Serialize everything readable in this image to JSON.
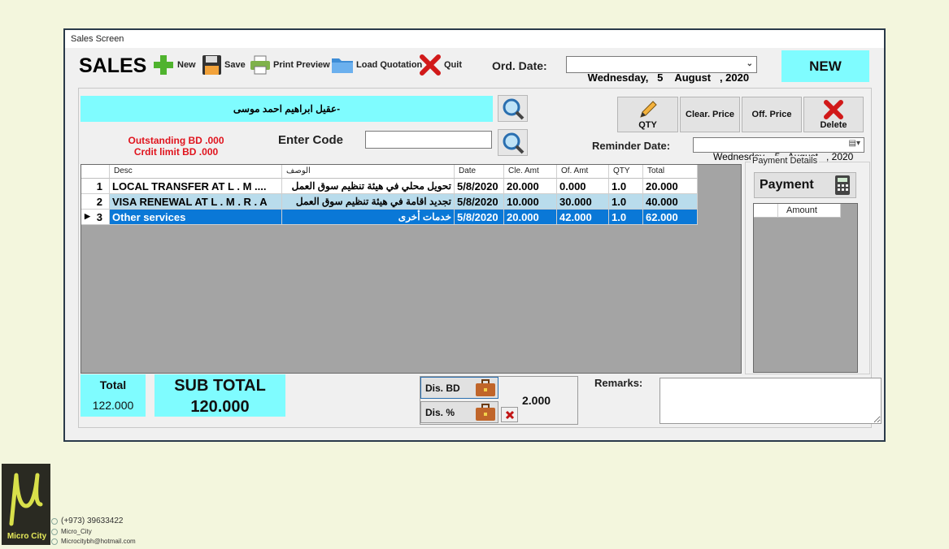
{
  "window": {
    "title": "Sales Screen"
  },
  "toolbar": {
    "app_title": "SALES",
    "new_label": "New",
    "save_label": "Save",
    "print_label": "Print Preview",
    "load_label": "Load Quotation",
    "quit_label": "Quit",
    "ord_date_label": "Ord. Date:",
    "ord_date_value": "Wednesday,   5    August   , 2020",
    "status_badge": "NEW"
  },
  "customer": {
    "name": "عقيل ابراهيم احمد موسى-",
    "outstanding": "Outstanding BD .000",
    "credit_limit": "Crdit limit BD .000",
    "enter_code_label": "Enter Code",
    "code_value": ""
  },
  "actions": {
    "qty_label": "QTY",
    "clear_price_label": "Clear. Price",
    "off_price_label": "Off. Price",
    "delete_label": "Delete",
    "reminder_label": "Reminder Date:",
    "reminder_value": "Wednesday,   5   August   , 2020"
  },
  "grid": {
    "columns": [
      "Desc",
      "الوصف",
      "Date",
      "Cle. Amt",
      "Of. Amt",
      "QTY",
      "Total"
    ],
    "rows": [
      {
        "num": "1",
        "desc": "LOCAL TRANSFER AT L . M ....",
        "desc_ar": "تحويل محلي في هيئة تنظيم سوق العمل",
        "date": "5/8/2020",
        "cle": "20.000",
        "of": "0.000",
        "qty": "1.0",
        "total": "20.000"
      },
      {
        "num": "2",
        "desc": "VISA RENEWAL AT L . M . R . A",
        "desc_ar": "تجديد اقامة في هيئة تنظيم سوق العمل",
        "date": "5/8/2020",
        "cle": "10.000",
        "of": "30.000",
        "qty": "1.0",
        "total": "40.000"
      },
      {
        "num": "3",
        "desc": "Other services",
        "desc_ar": "خدمات أخرى",
        "date": "5/8/2020",
        "cle": "20.000",
        "of": "42.000",
        "qty": "1.0",
        "total": "62.000"
      }
    ]
  },
  "payment": {
    "group_label": "Payment Details",
    "button_label": "Payment",
    "column": "Amount"
  },
  "totals": {
    "total_label": "Total",
    "total_value": "122.000",
    "sub_total_label": "SUB TOTAL",
    "sub_total_value": "120.000",
    "dis_bd_label": "Dis. BD",
    "dis_pct_label": "Dis. %",
    "discount_value": "2.000",
    "remarks_label": "Remarks:",
    "remarks_value": ""
  },
  "footer": {
    "logo_text": "Micro City",
    "phone": "(+973) 39633422",
    "handle": "Micro_City",
    "email": "Microcitybh@hotmail.com"
  },
  "colors": {
    "accent_cyan": "#7ffcff",
    "selected_row": "#0a78d7",
    "alt_row": "#b9dcec"
  }
}
